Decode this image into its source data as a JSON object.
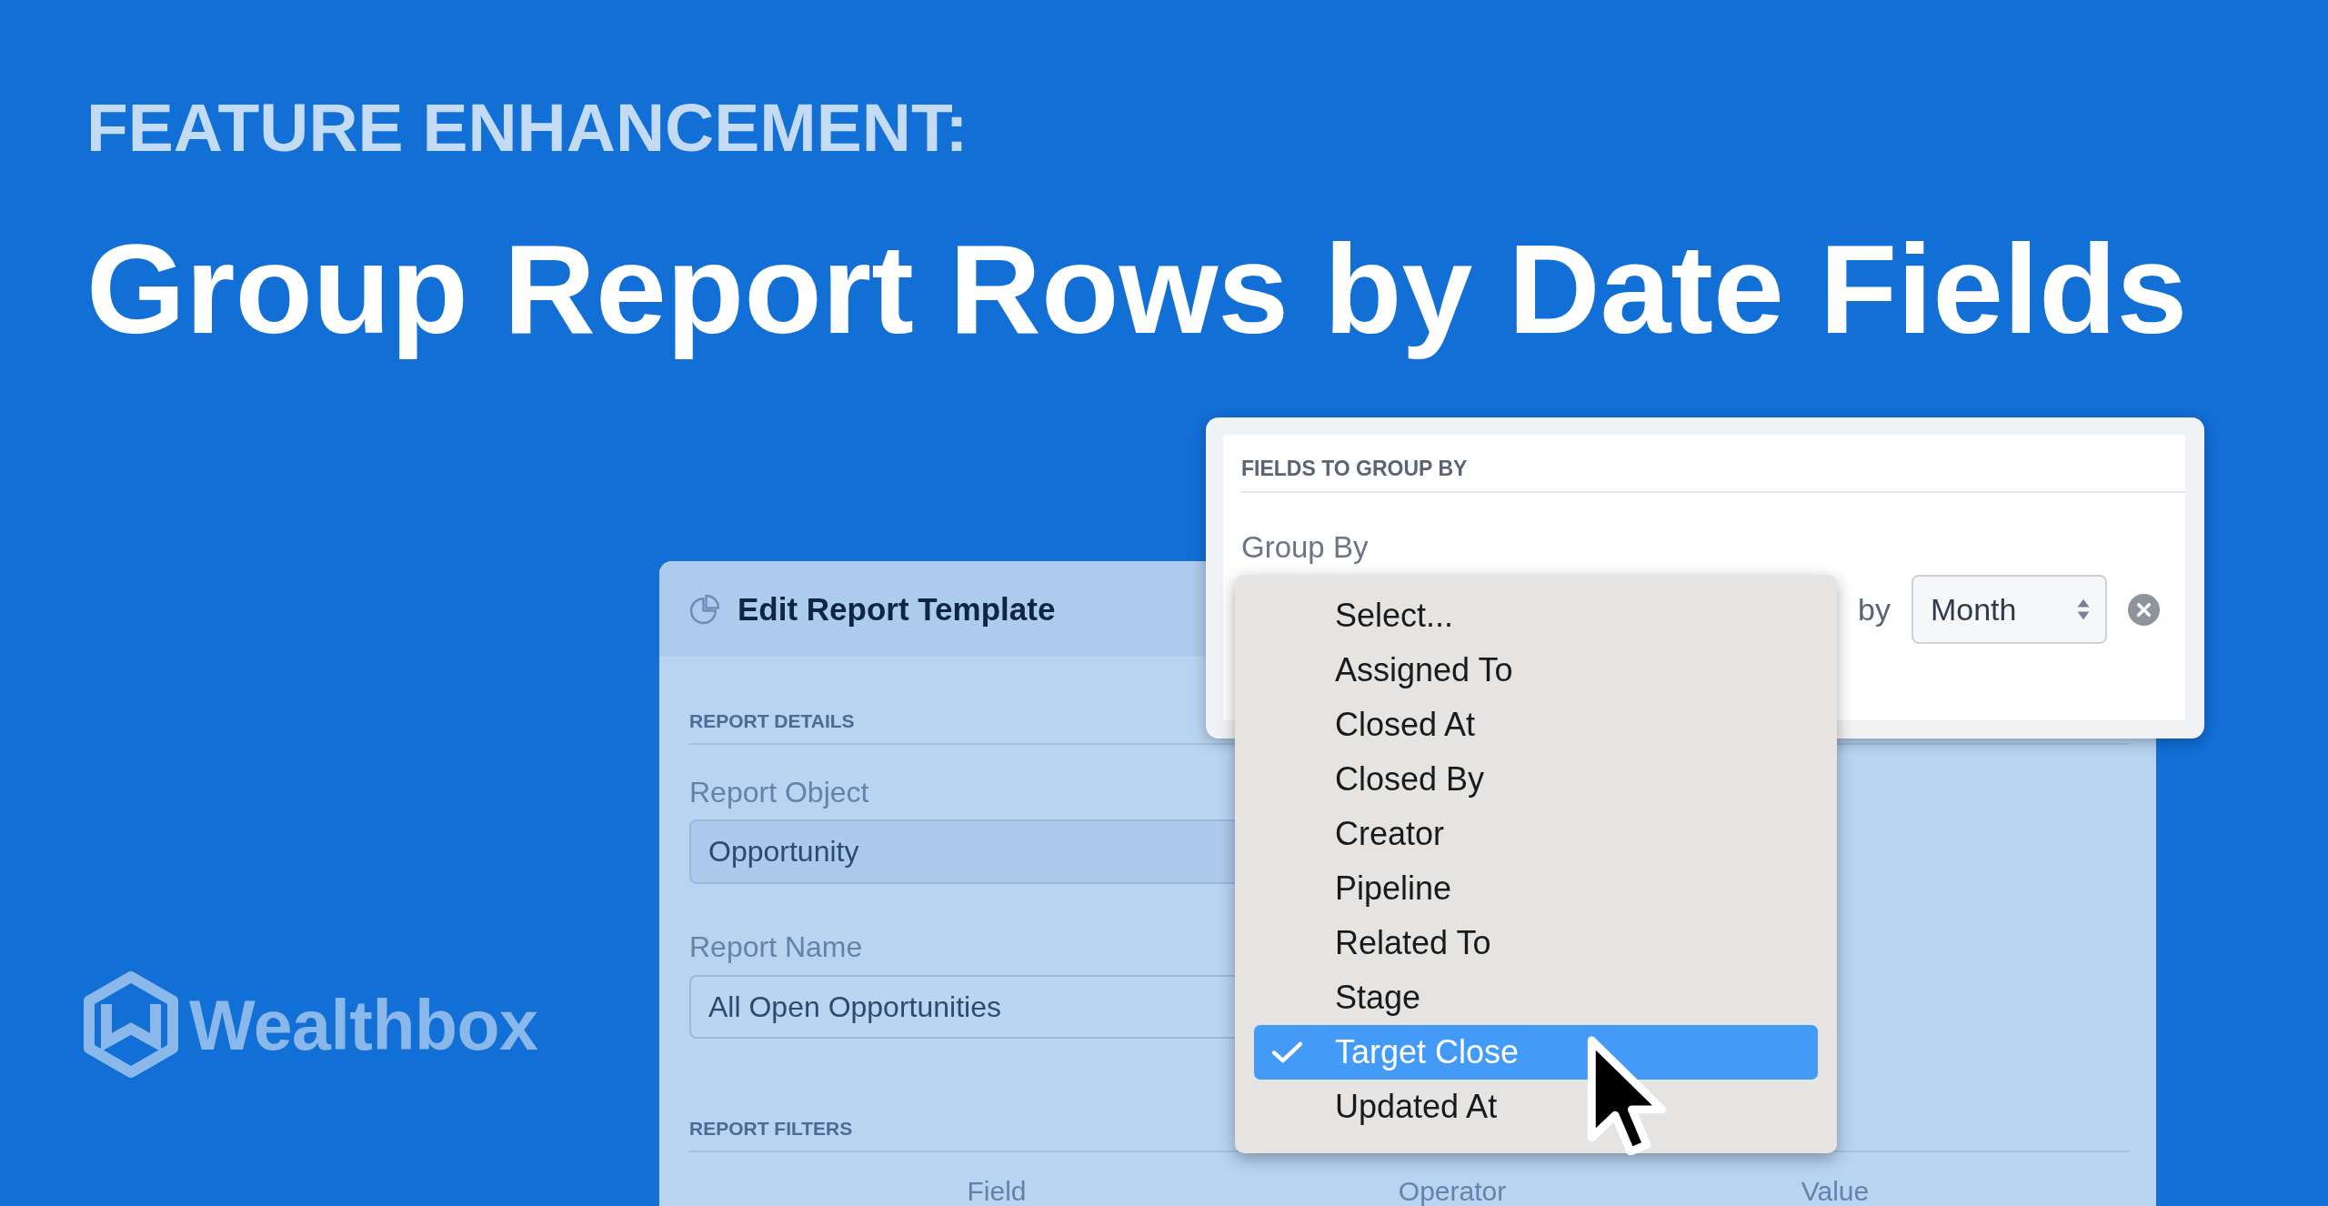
{
  "banner": {
    "kicker": "FEATURE ENHANCEMENT:",
    "title": "Group Report Rows by Date Fields"
  },
  "logo": {
    "wordmark": "Wealthbox"
  },
  "edit_report_card": {
    "title": "Edit Report Template",
    "details": {
      "heading": "REPORT DETAILS",
      "fields": [
        {
          "kind": "select",
          "label": "Report Object",
          "value": "Opportunity"
        },
        {
          "kind": "text",
          "label": "Report Name",
          "value": "All Open Opportunities"
        }
      ]
    },
    "filters": {
      "heading": "REPORT FILTERS",
      "columns": [
        "Field",
        "Operator",
        "Value"
      ]
    }
  },
  "group_by_card": {
    "heading": "FIELDS TO GROUP BY",
    "label": "Group By",
    "connector": "by",
    "interval": {
      "value": "Month"
    },
    "dropdown": {
      "options": [
        {
          "label": "Select...",
          "selected": false
        },
        {
          "label": "Assigned To",
          "selected": false
        },
        {
          "label": "Closed At",
          "selected": false
        },
        {
          "label": "Closed By",
          "selected": false
        },
        {
          "label": "Creator",
          "selected": false
        },
        {
          "label": "Pipeline",
          "selected": false
        },
        {
          "label": "Related To",
          "selected": false
        },
        {
          "label": "Stage",
          "selected": false
        },
        {
          "label": "Target Close",
          "selected": true
        },
        {
          "label": "Updated At",
          "selected": false
        }
      ]
    }
  }
}
